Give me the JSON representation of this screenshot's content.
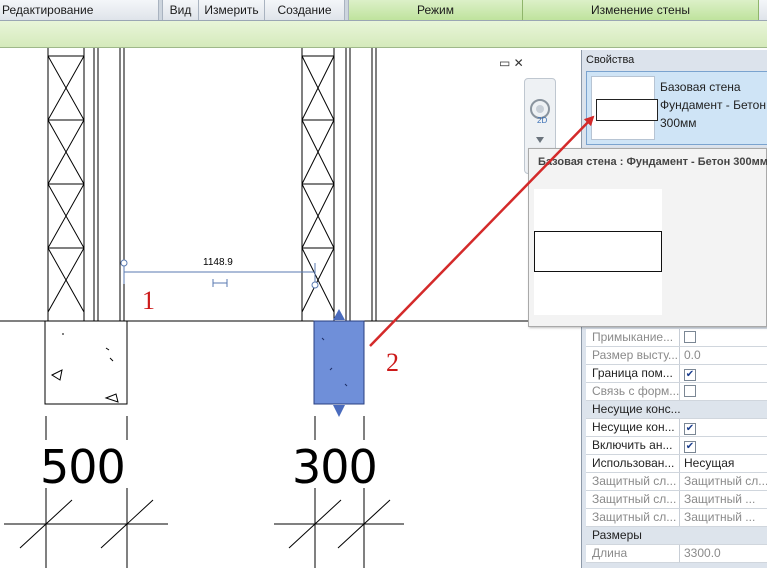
{
  "ribbon": {
    "tabs": [
      "Редактирование",
      "Вид",
      "Измерить",
      "Создание"
    ],
    "context_tabs": [
      "Режим",
      "Изменение стены"
    ]
  },
  "drawing": {
    "dimension_value": "1148.9",
    "label_left": "500",
    "label_right": "300",
    "callout_1": "1",
    "callout_2": "2",
    "nav_label": "2D",
    "view_controls": "▭ ✕",
    "colors": {
      "selected_wall": "#6f8fd9",
      "arrow": "#d42a2a",
      "dimension": "#5a7ab0"
    }
  },
  "properties": {
    "title": "Свойства",
    "type_line1": "Базовая стена",
    "type_line2": "Фундамент - Бетон",
    "type_line3": "300мм",
    "rows": [
      {
        "label": "Примыкание...",
        "value": "",
        "kind": "check",
        "checked": false,
        "disabled": true
      },
      {
        "label": "Размер высту...",
        "value": "0.0",
        "kind": "text",
        "disabled": true
      },
      {
        "label": "Граница пом...",
        "value": "",
        "kind": "check",
        "checked": true,
        "disabled": false
      },
      {
        "label": "Связь с форм...",
        "value": "",
        "kind": "check",
        "checked": false,
        "disabled": true
      },
      {
        "label": "Несущие конс...",
        "kind": "group"
      },
      {
        "label": "Несущие кон...",
        "value": "",
        "kind": "check",
        "checked": true,
        "disabled": false
      },
      {
        "label": "Включить ан...",
        "value": "",
        "kind": "check",
        "checked": true,
        "disabled": false
      },
      {
        "label": "Использован...",
        "value": "Несущая",
        "kind": "text",
        "disabled": false
      },
      {
        "label": "Защитный сл...",
        "value": "Защитный сл...",
        "kind": "text",
        "disabled": true
      },
      {
        "label": "Защитный сл...",
        "value": "Защитный ...",
        "kind": "text",
        "disabled": true
      },
      {
        "label": "Защитный сл...",
        "value": "Защитный ...",
        "kind": "text",
        "disabled": true
      },
      {
        "label": "Размеры",
        "kind": "group"
      },
      {
        "label": "Длина",
        "value": "3300.0",
        "kind": "text",
        "disabled": true
      }
    ]
  },
  "tooltip": {
    "title": "Базовая стена : Фундамент - Бетон 300мм"
  }
}
